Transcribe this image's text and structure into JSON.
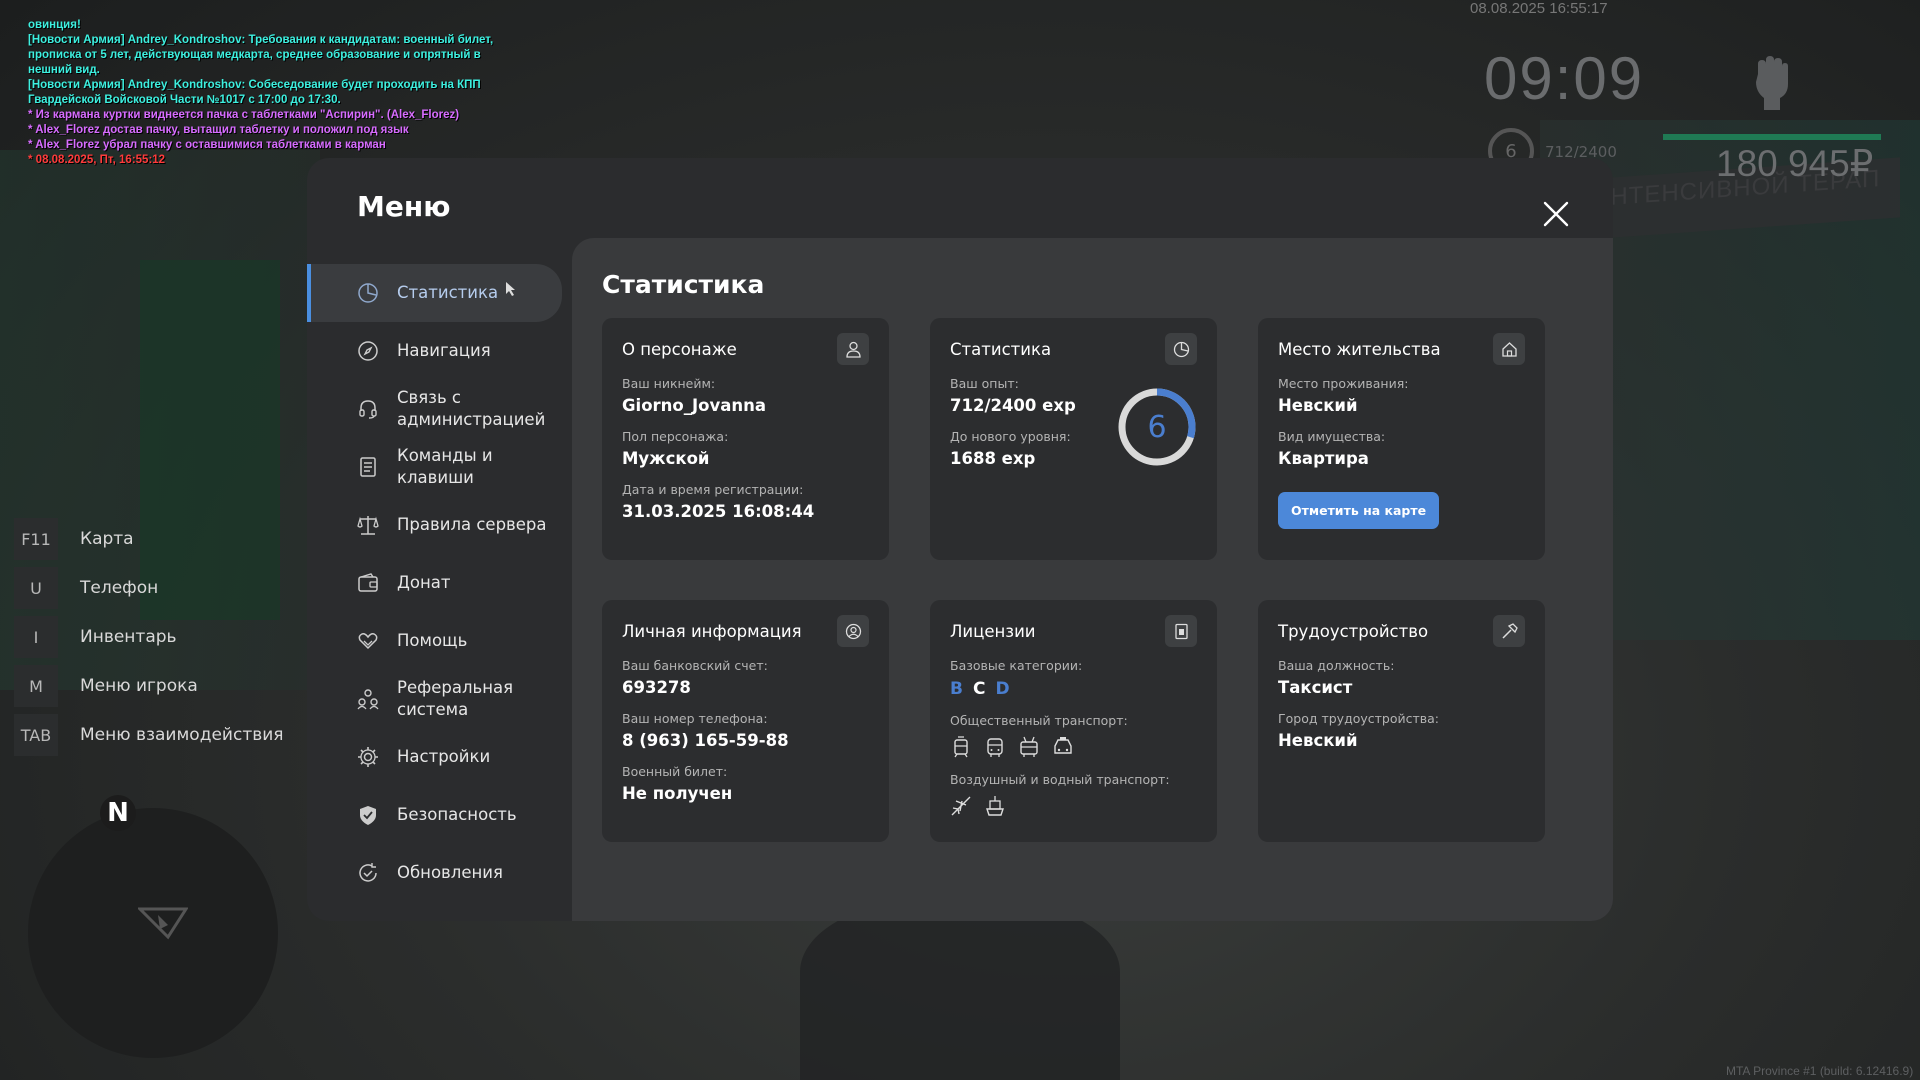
{
  "chat": [
    {
      "type": "news",
      "text": "овинция!"
    },
    {
      "type": "news",
      "text": "[Новости Армия] Andrey_Kondroshov: Требования к кандидатам: военный билет,"
    },
    {
      "type": "news",
      "text": " прописка от 5 лет, действующая медкарта, среднее образование и опрятный в"
    },
    {
      "type": "news",
      "text": "нешний вид."
    },
    {
      "type": "news",
      "text": "[Новости Армия] Andrey_Kondroshov: Собеседование будет проходить на КПП"
    },
    {
      "type": "news",
      "text": " Гвардейской Войсковой Части №1017 с 17:00 до 17:30."
    },
    {
      "type": "me",
      "text": "* Из кармана куртки виднеется пачка с таблетками \"Аспирин\". (Alex_Florez)"
    },
    {
      "type": "me",
      "text": "* Alex_Florez достав пачку, вытащил таблетку и положил под язык"
    },
    {
      "type": "me",
      "text": "* Alex_Florez убрал пачку с оставшимися таблетками в карман"
    },
    {
      "type": "red",
      "text": "* 08.08.2025, Пт, 16:55:12"
    }
  ],
  "hud": {
    "datetime": "08.08.2025 16:55:17",
    "clock": "09:09",
    "level": "6",
    "exp": "712/2400",
    "money": "180 945₽",
    "health_fraction": 1.0,
    "health_color": "#1f7a54",
    "fist_icon": "fist-icon"
  },
  "background": {
    "sign_text": "ИКАЦИИ И ИНТЕНСИВНОЙ ТЕРАП"
  },
  "hotkeys": [
    {
      "key": "F11",
      "label": "Карта"
    },
    {
      "key": "U",
      "label": "Телефон"
    },
    {
      "key": "I",
      "label": "Инвентарь"
    },
    {
      "key": "M",
      "label": "Меню игрока"
    },
    {
      "key": "TAB",
      "label": "Меню взаимодействия"
    }
  ],
  "minimap": {
    "north_label": "N"
  },
  "menu": {
    "title": "Меню",
    "nav": [
      {
        "label": "Статистика",
        "icon": "pie-chart-icon",
        "active": true
      },
      {
        "label": "Навигация",
        "icon": "compass-icon"
      },
      {
        "label": "Связь с\nадминистрацией",
        "icon": "headset-icon"
      },
      {
        "label": "Команды и\nклавиши",
        "icon": "document-icon"
      },
      {
        "label": "Правила сервера",
        "icon": "scales-icon"
      },
      {
        "label": "Донат",
        "icon": "wallet-icon"
      },
      {
        "label": "Помощь",
        "icon": "heart-hand-icon"
      },
      {
        "label": "Реферальная\nсистема",
        "icon": "users-icon"
      },
      {
        "label": "Настройки",
        "icon": "gear-icon"
      },
      {
        "label": "Безопасность",
        "icon": "shield-icon"
      },
      {
        "label": "Обновления",
        "icon": "refresh-check-icon"
      }
    ],
    "accent_color": "#4a8fe0"
  },
  "content": {
    "title": "Статистика",
    "character": {
      "title": "О персонаже",
      "icon": "person-icon",
      "nickname_label": "Ваш никнейм:",
      "nickname": "Giorno_Jovanna",
      "gender_label": "Пол персонажа:",
      "gender": "Мужской",
      "reg_label": "Дата и время регистрации:",
      "reg": "31.03.2025 16:08:44"
    },
    "stats": {
      "title": "Статистика",
      "icon": "pie-chart-icon",
      "exp_label": "Ваш опыт:",
      "exp": "712/2400 exp",
      "next_label": "До нового уровня:",
      "next": "1688 exp",
      "level": "6",
      "progress_fraction": 0.2967,
      "ring_color": "#4a7ecf",
      "ring_track_color": "#d9d9d9"
    },
    "residence": {
      "title": "Место жительства",
      "icon": "house-icon",
      "place_label": "Место проживания:",
      "place": "Невский",
      "property_label": "Вид имущества:",
      "property": "Квартира",
      "button": "Отметить на карте",
      "button_color": "#4c88d9"
    },
    "personal": {
      "title": "Личная информация",
      "icon": "user-circle-icon",
      "bank_label": "Ваш банковский счет:",
      "bank": "693278",
      "phone_label": "Ваш номер телефона:",
      "phone": "8 (963) 165-59-88",
      "military_label": "Военный билет:",
      "military": "Не получен"
    },
    "licenses": {
      "title": "Лицензии",
      "icon": "license-icon",
      "basic_label": "Базовые категории:",
      "categories": [
        "B",
        "C",
        "D"
      ],
      "public_label": "Общественный транспорт:",
      "public_icons": [
        "tram-icon",
        "bus-icon",
        "trolleybus-icon",
        "taxi-icon"
      ],
      "air_label": "Воздушный и водный транспорт:",
      "air_icons": [
        "plane-icon",
        "ship-icon"
      ]
    },
    "job": {
      "title": "Трудоустройство",
      "icon": "hammer-icon",
      "position_label": "Ваша должность:",
      "position": "Таксист",
      "city_label": "Город трудоустройства:",
      "city": "Невский"
    }
  },
  "watermark": "MTA Province #1 (build: 6.12416.9)"
}
